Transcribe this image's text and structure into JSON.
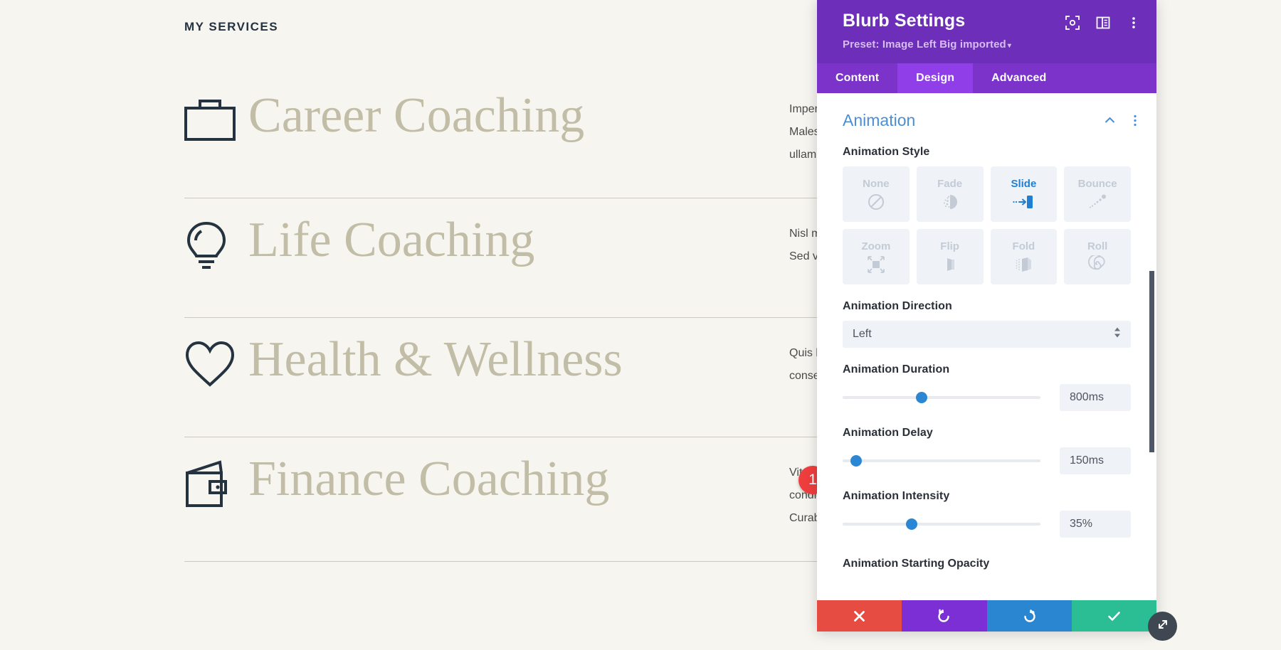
{
  "page": {
    "eyebrow": "MY SERVICES",
    "services": [
      {
        "icon": "briefcase-icon",
        "title": "Career Coaching",
        "body_lines": [
          "Imperdie",
          "Malesuad",
          "ullamcor"
        ]
      },
      {
        "icon": "lightbulb-icon",
        "title": "Life Coaching",
        "body_lines": [
          "Nisl mass",
          "Sed vitae"
        ]
      },
      {
        "icon": "heart-icon",
        "title": "Health & Wellness",
        "body_lines": [
          "Quis blan",
          "consequa"
        ]
      },
      {
        "icon": "wallet-icon",
        "title": "Finance Coaching",
        "body_lines": [
          "Vitae cor",
          "condi",
          "Curabitu"
        ]
      }
    ],
    "marker_badge": "1"
  },
  "modal": {
    "title": "Blurb Settings",
    "preset": "Preset: Image Left Big imported",
    "preset_caret": "▾",
    "header_icons": [
      {
        "name": "focus-target-icon"
      },
      {
        "name": "layout-panel-icon"
      },
      {
        "name": "more-vertical-icon"
      }
    ],
    "tabs": [
      {
        "label": "Content",
        "active": false
      },
      {
        "label": "Design",
        "active": true
      },
      {
        "label": "Advanced",
        "active": false
      }
    ],
    "section": {
      "title": "Animation",
      "collapse_icon": "chevron-up-icon",
      "options_icon": "more-vertical-icon"
    },
    "fields": {
      "animation_style": {
        "label": "Animation Style",
        "options": [
          {
            "label": "None",
            "icon": "no-entry-icon",
            "selected": false
          },
          {
            "label": "Fade",
            "icon": "fade-icon",
            "selected": false
          },
          {
            "label": "Slide",
            "icon": "slide-icon",
            "selected": true
          },
          {
            "label": "Bounce",
            "icon": "bounce-icon",
            "selected": false
          },
          {
            "label": "Zoom",
            "icon": "zoom-arrows-icon",
            "selected": false
          },
          {
            "label": "Flip",
            "icon": "flip-icon",
            "selected": false
          },
          {
            "label": "Fold",
            "icon": "fold-icon",
            "selected": false
          },
          {
            "label": "Roll",
            "icon": "roll-spiral-icon",
            "selected": false
          }
        ]
      },
      "animation_direction": {
        "label": "Animation Direction",
        "value": "Left"
      },
      "animation_duration": {
        "label": "Animation Duration",
        "value": "800ms",
        "slider_percent": 40
      },
      "animation_delay": {
        "label": "Animation Delay",
        "value": "150ms",
        "slider_percent": 7
      },
      "animation_intensity": {
        "label": "Animation Intensity",
        "value": "35%",
        "slider_percent": 35
      },
      "animation_starting_opacity": {
        "label": "Animation Starting Opacity"
      }
    },
    "footer": [
      {
        "name": "cancel-button",
        "icon": "x-icon",
        "color": "#e74c43"
      },
      {
        "name": "undo-button",
        "icon": "undo-icon",
        "color": "#7b2fd4"
      },
      {
        "name": "redo-button",
        "icon": "redo-icon",
        "color": "#2a86d0"
      },
      {
        "name": "save-button",
        "icon": "check-icon",
        "color": "#2bbd94"
      }
    ]
  },
  "colors": {
    "brand_purple": "#6d2eb9",
    "tab_active": "#8f3ee8",
    "accent_blue": "#4a8fd4",
    "slider_blue": "#2b87d4",
    "page_bg": "#f7f5f0",
    "title_tan": "#c2bda6",
    "marker_red": "#ef3e3e"
  }
}
